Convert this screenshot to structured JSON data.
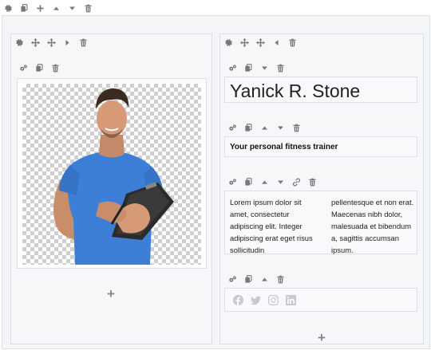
{
  "toolbar_icons": {
    "settings": "gear-icon",
    "duplicate": "copy-icon",
    "add": "plus-icon",
    "move_up": "caret-up-icon",
    "move_down": "caret-down-icon",
    "delete": "trash-icon"
  },
  "left_column": {
    "image_alt": "Personal trainer holding a clipboard",
    "add_label": "+"
  },
  "right_column": {
    "heading": "Yanick R. Stone",
    "subheading": "Your personal fitness trainer",
    "text_col_1": "Lorem ipsum dolor sit amet, consectetur adipiscing elit. Integer adipiscing erat eget risus sollicitudin",
    "text_col_2": "pellentesque et non erat. Maecenas nibh dolor, malesuada et bibendum a, sagittis accumsan ipsum.",
    "social": [
      "facebook-icon",
      "twitter-icon",
      "instagram-icon",
      "linkedin-icon"
    ],
    "add_label": "+"
  },
  "colors": {
    "icon": "#777777",
    "social_icon": "#c7c9cc",
    "shirt": "#3d7fd6",
    "canvas_bg": "#f4f5f7"
  }
}
